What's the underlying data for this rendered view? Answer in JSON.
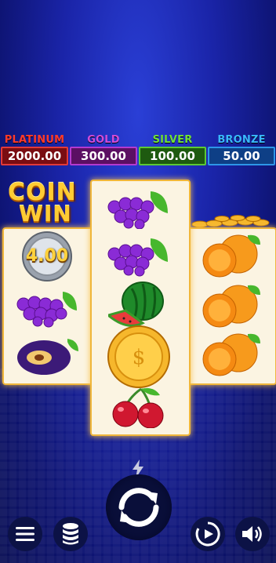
{
  "jackpots": [
    {
      "name": "PLATINUM",
      "value": "2000.00"
    },
    {
      "name": "GOLD",
      "value": "300.00"
    },
    {
      "name": "SILVER",
      "value": "100.00"
    },
    {
      "name": "BRONZE",
      "value": "50.00"
    }
  ],
  "logo": {
    "line1": "COIN",
    "line2": "WIN"
  },
  "reels": {
    "col1": [
      "coin",
      "grapes",
      "plum"
    ],
    "col2": [
      "grapes",
      "grapes",
      "watermelon",
      "gold-coin",
      "cherries"
    ],
    "col3": [
      "orange",
      "orange",
      "orange"
    ]
  },
  "coin_value": "4.00",
  "controls": {
    "menu_icon": "hamburger-menu-icon",
    "bet_icon": "coin-stack-icon",
    "spin_icon": "refresh-icon",
    "turbo_icon": "lightning-icon",
    "autoplay_icon": "play-circle-icon",
    "sound_icon": "speaker-icon"
  },
  "colors": {
    "frame": "#f0b63a",
    "background": "#1a24a8"
  }
}
